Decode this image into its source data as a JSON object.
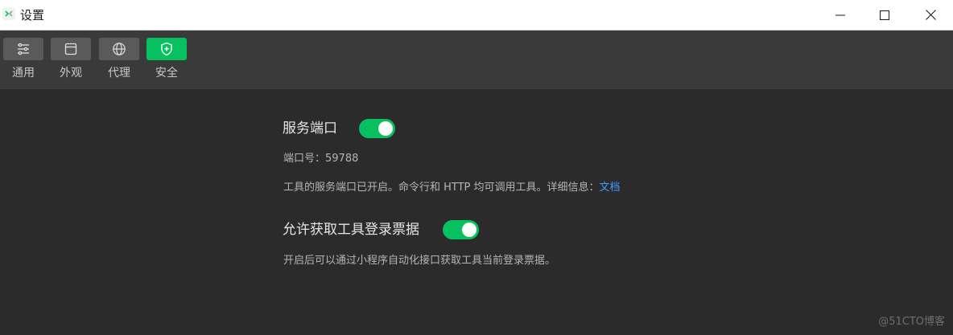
{
  "window": {
    "title": "设置"
  },
  "toolbar": {
    "items": [
      {
        "label": "通用",
        "icon": "sliders-icon",
        "active": false
      },
      {
        "label": "外观",
        "icon": "window-icon",
        "active": false
      },
      {
        "label": "代理",
        "icon": "globe-icon",
        "active": false
      },
      {
        "label": "安全",
        "icon": "shield-icon",
        "active": true
      }
    ]
  },
  "settings": {
    "service_port": {
      "title": "服务端口",
      "enabled": true,
      "port_label": "端口号：59788",
      "description": "工具的服务端口已开启。命令行和 HTTP 均可调用工具。详细信息：",
      "doc_link": "文档"
    },
    "login_ticket": {
      "title": "允许获取工具登录票据",
      "enabled": true,
      "description": "开启后可以通过小程序自动化接口获取工具当前登录票据。"
    }
  },
  "watermark": "@51CTO博客",
  "colors": {
    "accent": "#07c160",
    "link": "#3c9eff",
    "background": "#2b2b2b",
    "toolbar": "#3a3a3a"
  }
}
